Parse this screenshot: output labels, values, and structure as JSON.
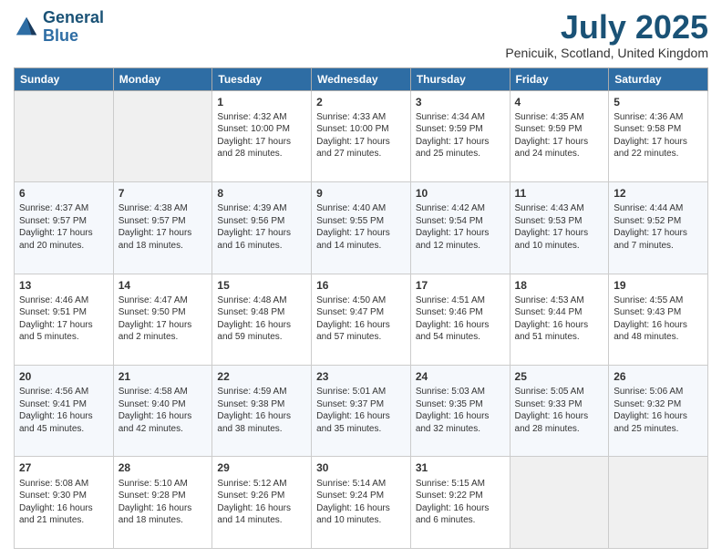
{
  "header": {
    "logo_line1": "General",
    "logo_line2": "Blue",
    "month": "July 2025",
    "location": "Penicuik, Scotland, United Kingdom"
  },
  "days_of_week": [
    "Sunday",
    "Monday",
    "Tuesday",
    "Wednesday",
    "Thursday",
    "Friday",
    "Saturday"
  ],
  "weeks": [
    [
      {
        "day": null,
        "sunrise": null,
        "sunset": null,
        "daylight": null
      },
      {
        "day": null,
        "sunrise": null,
        "sunset": null,
        "daylight": null
      },
      {
        "day": "1",
        "sunrise": "Sunrise: 4:32 AM",
        "sunset": "Sunset: 10:00 PM",
        "daylight": "Daylight: 17 hours and 28 minutes."
      },
      {
        "day": "2",
        "sunrise": "Sunrise: 4:33 AM",
        "sunset": "Sunset: 10:00 PM",
        "daylight": "Daylight: 17 hours and 27 minutes."
      },
      {
        "day": "3",
        "sunrise": "Sunrise: 4:34 AM",
        "sunset": "Sunset: 9:59 PM",
        "daylight": "Daylight: 17 hours and 25 minutes."
      },
      {
        "day": "4",
        "sunrise": "Sunrise: 4:35 AM",
        "sunset": "Sunset: 9:59 PM",
        "daylight": "Daylight: 17 hours and 24 minutes."
      },
      {
        "day": "5",
        "sunrise": "Sunrise: 4:36 AM",
        "sunset": "Sunset: 9:58 PM",
        "daylight": "Daylight: 17 hours and 22 minutes."
      }
    ],
    [
      {
        "day": "6",
        "sunrise": "Sunrise: 4:37 AM",
        "sunset": "Sunset: 9:57 PM",
        "daylight": "Daylight: 17 hours and 20 minutes."
      },
      {
        "day": "7",
        "sunrise": "Sunrise: 4:38 AM",
        "sunset": "Sunset: 9:57 PM",
        "daylight": "Daylight: 17 hours and 18 minutes."
      },
      {
        "day": "8",
        "sunrise": "Sunrise: 4:39 AM",
        "sunset": "Sunset: 9:56 PM",
        "daylight": "Daylight: 17 hours and 16 minutes."
      },
      {
        "day": "9",
        "sunrise": "Sunrise: 4:40 AM",
        "sunset": "Sunset: 9:55 PM",
        "daylight": "Daylight: 17 hours and 14 minutes."
      },
      {
        "day": "10",
        "sunrise": "Sunrise: 4:42 AM",
        "sunset": "Sunset: 9:54 PM",
        "daylight": "Daylight: 17 hours and 12 minutes."
      },
      {
        "day": "11",
        "sunrise": "Sunrise: 4:43 AM",
        "sunset": "Sunset: 9:53 PM",
        "daylight": "Daylight: 17 hours and 10 minutes."
      },
      {
        "day": "12",
        "sunrise": "Sunrise: 4:44 AM",
        "sunset": "Sunset: 9:52 PM",
        "daylight": "Daylight: 17 hours and 7 minutes."
      }
    ],
    [
      {
        "day": "13",
        "sunrise": "Sunrise: 4:46 AM",
        "sunset": "Sunset: 9:51 PM",
        "daylight": "Daylight: 17 hours and 5 minutes."
      },
      {
        "day": "14",
        "sunrise": "Sunrise: 4:47 AM",
        "sunset": "Sunset: 9:50 PM",
        "daylight": "Daylight: 17 hours and 2 minutes."
      },
      {
        "day": "15",
        "sunrise": "Sunrise: 4:48 AM",
        "sunset": "Sunset: 9:48 PM",
        "daylight": "Daylight: 16 hours and 59 minutes."
      },
      {
        "day": "16",
        "sunrise": "Sunrise: 4:50 AM",
        "sunset": "Sunset: 9:47 PM",
        "daylight": "Daylight: 16 hours and 57 minutes."
      },
      {
        "day": "17",
        "sunrise": "Sunrise: 4:51 AM",
        "sunset": "Sunset: 9:46 PM",
        "daylight": "Daylight: 16 hours and 54 minutes."
      },
      {
        "day": "18",
        "sunrise": "Sunrise: 4:53 AM",
        "sunset": "Sunset: 9:44 PM",
        "daylight": "Daylight: 16 hours and 51 minutes."
      },
      {
        "day": "19",
        "sunrise": "Sunrise: 4:55 AM",
        "sunset": "Sunset: 9:43 PM",
        "daylight": "Daylight: 16 hours and 48 minutes."
      }
    ],
    [
      {
        "day": "20",
        "sunrise": "Sunrise: 4:56 AM",
        "sunset": "Sunset: 9:41 PM",
        "daylight": "Daylight: 16 hours and 45 minutes."
      },
      {
        "day": "21",
        "sunrise": "Sunrise: 4:58 AM",
        "sunset": "Sunset: 9:40 PM",
        "daylight": "Daylight: 16 hours and 42 minutes."
      },
      {
        "day": "22",
        "sunrise": "Sunrise: 4:59 AM",
        "sunset": "Sunset: 9:38 PM",
        "daylight": "Daylight: 16 hours and 38 minutes."
      },
      {
        "day": "23",
        "sunrise": "Sunrise: 5:01 AM",
        "sunset": "Sunset: 9:37 PM",
        "daylight": "Daylight: 16 hours and 35 minutes."
      },
      {
        "day": "24",
        "sunrise": "Sunrise: 5:03 AM",
        "sunset": "Sunset: 9:35 PM",
        "daylight": "Daylight: 16 hours and 32 minutes."
      },
      {
        "day": "25",
        "sunrise": "Sunrise: 5:05 AM",
        "sunset": "Sunset: 9:33 PM",
        "daylight": "Daylight: 16 hours and 28 minutes."
      },
      {
        "day": "26",
        "sunrise": "Sunrise: 5:06 AM",
        "sunset": "Sunset: 9:32 PM",
        "daylight": "Daylight: 16 hours and 25 minutes."
      }
    ],
    [
      {
        "day": "27",
        "sunrise": "Sunrise: 5:08 AM",
        "sunset": "Sunset: 9:30 PM",
        "daylight": "Daylight: 16 hours and 21 minutes."
      },
      {
        "day": "28",
        "sunrise": "Sunrise: 5:10 AM",
        "sunset": "Sunset: 9:28 PM",
        "daylight": "Daylight: 16 hours and 18 minutes."
      },
      {
        "day": "29",
        "sunrise": "Sunrise: 5:12 AM",
        "sunset": "Sunset: 9:26 PM",
        "daylight": "Daylight: 16 hours and 14 minutes."
      },
      {
        "day": "30",
        "sunrise": "Sunrise: 5:14 AM",
        "sunset": "Sunset: 9:24 PM",
        "daylight": "Daylight: 16 hours and 10 minutes."
      },
      {
        "day": "31",
        "sunrise": "Sunrise: 5:15 AM",
        "sunset": "Sunset: 9:22 PM",
        "daylight": "Daylight: 16 hours and 6 minutes."
      },
      {
        "day": null,
        "sunrise": null,
        "sunset": null,
        "daylight": null
      },
      {
        "day": null,
        "sunrise": null,
        "sunset": null,
        "daylight": null
      }
    ]
  ]
}
